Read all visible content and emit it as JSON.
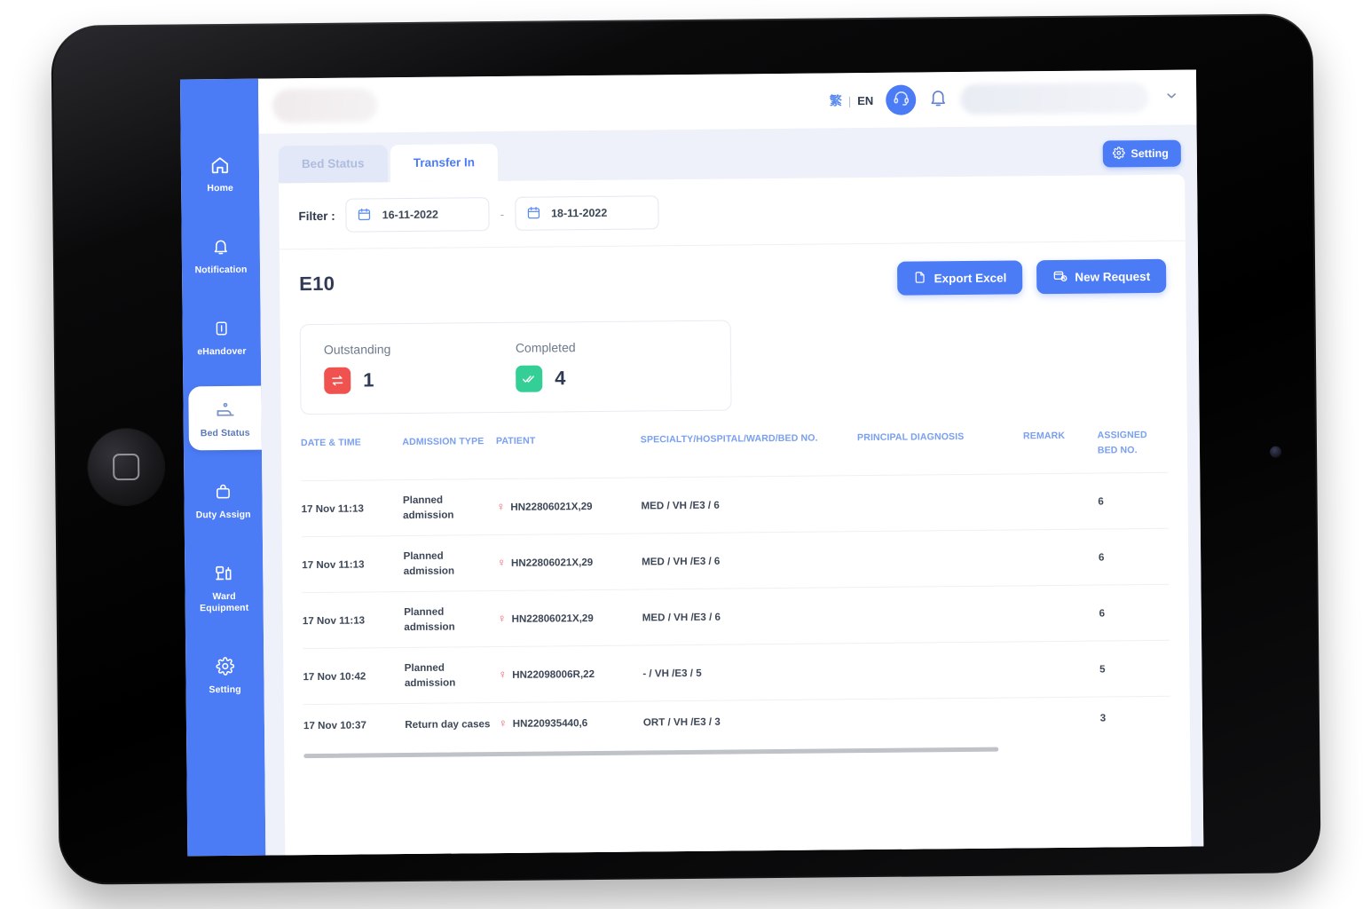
{
  "topbar": {
    "lang_zh": "繁",
    "lang_divider": "|",
    "lang_en": "EN",
    "support_icon": "headset-icon",
    "bell_icon": "bell-icon",
    "caret_icon": "chevron-down-icon"
  },
  "sidebar": {
    "items": [
      {
        "label": "Home",
        "icon": "home-icon",
        "active": false
      },
      {
        "label": "Notification",
        "icon": "bell-icon",
        "active": false
      },
      {
        "label": "eHandover",
        "icon": "clipboard-icon",
        "active": false
      },
      {
        "label": "Bed Status",
        "icon": "bed-icon",
        "active": true
      },
      {
        "label": "Duty Assign",
        "icon": "bag-icon",
        "active": false
      },
      {
        "label": "Ward\nEquipment",
        "label_line1": "Ward",
        "label_line2": "Equipment",
        "icon": "equipment-icon",
        "active": false
      },
      {
        "label": "Setting",
        "icon": "gear-icon",
        "active": false
      }
    ]
  },
  "tabs": [
    {
      "label": "Bed Status",
      "active": false
    },
    {
      "label": "Transfer In",
      "active": true
    }
  ],
  "setting_button": {
    "label": "Setting",
    "icon": "gear-icon"
  },
  "filter": {
    "label": "Filter :",
    "date_from": "16-11-2022",
    "date_to": "18-11-2022",
    "separator": "-",
    "calendar_icon": "calendar-icon"
  },
  "ward": {
    "title": "E10",
    "export_button": {
      "label": "Export Excel",
      "icon": "file-icon"
    },
    "new_request_button": {
      "label": "New Request",
      "icon": "request-icon"
    }
  },
  "stats": [
    {
      "label": "Outstanding",
      "value": "1",
      "icon": "transfer-icon",
      "color": "#f0534f"
    },
    {
      "label": "Completed",
      "value": "4",
      "icon": "double-check-icon",
      "color": "#34cf96"
    }
  ],
  "table": {
    "columns": [
      "DATE & TIME",
      "ADMISSION TYPE",
      "PATIENT",
      "SPECIALTY/HOSPITAL/WARD/BED NO.",
      "PRINCIPAL DIAGNOSIS",
      "REMARK",
      "ASSIGNED BED NO."
    ],
    "rows": [
      {
        "datetime": "17 Nov 11:13",
        "admission_type": "Planned admission",
        "gender_icon": "female-icon",
        "patient": "HN22806021X,29",
        "specialty": "MED / VH /E3 / 6",
        "diagnosis": "",
        "remark": "",
        "assigned_bed": "6"
      },
      {
        "datetime": "17 Nov 11:13",
        "admission_type": "Planned admission",
        "gender_icon": "female-icon",
        "patient": "HN22806021X,29",
        "specialty": "MED / VH /E3 / 6",
        "diagnosis": "",
        "remark": "",
        "assigned_bed": "6"
      },
      {
        "datetime": "17 Nov 11:13",
        "admission_type": "Planned admission",
        "gender_icon": "female-icon",
        "patient": "HN22806021X,29",
        "specialty": "MED / VH /E3 / 6",
        "diagnosis": "",
        "remark": "",
        "assigned_bed": "6"
      },
      {
        "datetime": "17 Nov 10:42",
        "admission_type": "Planned admission",
        "gender_icon": "female-icon",
        "patient": "HN22098006R,22",
        "specialty": "- / VH /E3 / 5",
        "diagnosis": "",
        "remark": "",
        "assigned_bed": "5"
      },
      {
        "datetime": "17 Nov 10:37",
        "admission_type": "Return day cases",
        "gender_icon": "female-icon",
        "patient": "HN220935440,6",
        "specialty": "ORT / VH /E3 / 3",
        "diagnosis": "",
        "remark": "",
        "assigned_bed": "3"
      }
    ]
  },
  "colors": {
    "brand_blue": "#4b7bf5",
    "sidebar_blue": "#4b7bf5",
    "header_text_blue": "#7ba0ef",
    "danger_red": "#f0534f",
    "success_green": "#34cf96",
    "page_bg": "#eef1fa"
  }
}
